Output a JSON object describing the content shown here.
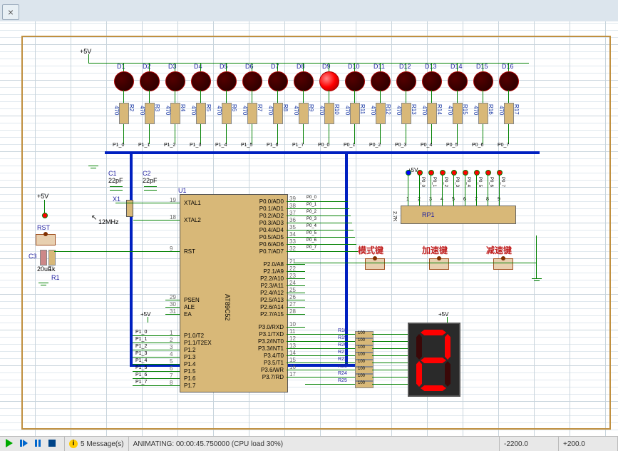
{
  "tab": {
    "close": "×"
  },
  "power": {
    "p5v": "+5V"
  },
  "leds": {
    "names": [
      "D1",
      "D2",
      "D3",
      "D4",
      "D5",
      "D6",
      "D7",
      "D8",
      "D9",
      "D10",
      "D11",
      "D12",
      "D13",
      "D14",
      "D15",
      "D16"
    ],
    "lit_index": 8
  },
  "resistors": {
    "names": [
      "R2",
      "R3",
      "R4",
      "R5",
      "R6",
      "R7",
      "R8",
      "R9",
      "R10",
      "R11",
      "R12",
      "R13",
      "R14",
      "R15",
      "R16",
      "R17"
    ],
    "value": "470"
  },
  "netlabels": [
    "P1_0",
    "P1_1",
    "P1_2",
    "P1_3",
    "P1_4",
    "P1_5",
    "P1_6",
    "P1_7",
    "P0_0",
    "P0_1",
    "P0_2",
    "P0_3",
    "P0_4",
    "P0_5",
    "P0_6",
    "P0_7"
  ],
  "caps": {
    "C1": {
      "name": "C1",
      "val": "22pF"
    },
    "C2": {
      "name": "C2",
      "val": "22pF"
    },
    "C3": {
      "name": "C3",
      "val": "20uF"
    }
  },
  "xtal": {
    "name": "X1",
    "val": "12MHz"
  },
  "rst": {
    "label": "RST",
    "r1": "R1",
    "r1val": "1k"
  },
  "chip": {
    "name": "U1",
    "part": "AT89C52",
    "left": [
      {
        "no": "19",
        "lab": "XTAL1"
      },
      {
        "no": "18",
        "lab": "XTAL2"
      },
      {
        "no": "9",
        "lab": "RST"
      },
      {
        "no": "29",
        "lab": "PSEN"
      },
      {
        "no": "30",
        "lab": "ALE"
      },
      {
        "no": "31",
        "lab": "EA"
      },
      {
        "no": "1",
        "lab": "P1.0/T2"
      },
      {
        "no": "2",
        "lab": "P1.1/T2EX"
      },
      {
        "no": "3",
        "lab": "P1.2"
      },
      {
        "no": "4",
        "lab": "P1.3"
      },
      {
        "no": "5",
        "lab": "P1.4"
      },
      {
        "no": "6",
        "lab": "P1.5"
      },
      {
        "no": "7",
        "lab": "P1.6"
      },
      {
        "no": "8",
        "lab": "P1.7"
      }
    ],
    "right": [
      {
        "no": "39",
        "lab": "P0.0/AD0"
      },
      {
        "no": "38",
        "lab": "P0.1/AD1"
      },
      {
        "no": "37",
        "lab": "P0.2/AD2"
      },
      {
        "no": "36",
        "lab": "P0.3/AD3"
      },
      {
        "no": "35",
        "lab": "P0.4/AD4"
      },
      {
        "no": "34",
        "lab": "P0.5/AD5"
      },
      {
        "no": "33",
        "lab": "P0.6/AD6"
      },
      {
        "no": "32",
        "lab": "P0.7/AD7"
      },
      {
        "no": "21",
        "lab": "P2.0/A8"
      },
      {
        "no": "22",
        "lab": "P2.1/A9"
      },
      {
        "no": "23",
        "lab": "P2.2/A10"
      },
      {
        "no": "24",
        "lab": "P2.3/A11"
      },
      {
        "no": "25",
        "lab": "P2.4/A12"
      },
      {
        "no": "26",
        "lab": "P2.5/A13"
      },
      {
        "no": "27",
        "lab": "P2.6/A14"
      },
      {
        "no": "28",
        "lab": "P2.7/A15"
      },
      {
        "no": "10",
        "lab": "P3.0/RXD"
      },
      {
        "no": "11",
        "lab": "P3.1/TXD"
      },
      {
        "no": "12",
        "lab": "P3.2/INT0"
      },
      {
        "no": "13",
        "lab": "P3.3/INT1"
      },
      {
        "no": "14",
        "lab": "P3.4/T0"
      },
      {
        "no": "15",
        "lab": "P3.5/T1"
      },
      {
        "no": "16",
        "lab": "P3.6/WR"
      },
      {
        "no": "17",
        "lab": "P3.7/RD"
      }
    ]
  },
  "busports_left": [
    "P1_0",
    "P1_1",
    "P1_2",
    "P1_3",
    "P1_4",
    "P1_5",
    "P1_6",
    "P1_7"
  ],
  "rp1": {
    "name": "RP1",
    "val": "2.7K",
    "pins": [
      "1",
      "2",
      "3",
      "4",
      "5",
      "6",
      "7",
      "8",
      "9"
    ],
    "nets": [
      "P0_0",
      "P0_1",
      "P0_2",
      "P0_3",
      "P0_4",
      "P0_5",
      "P0_6",
      "P0_7"
    ]
  },
  "buttons": {
    "mode": "模式键",
    "up": "加速键",
    "down": "减速键"
  },
  "p3res": {
    "names": [
      "R18",
      "R19",
      "R20",
      "R21",
      "R22",
      "R23",
      "R24",
      "R25"
    ],
    "val": "100"
  },
  "seg7": {
    "digit": "2",
    "segs": {
      "a": true,
      "b": true,
      "c": false,
      "d": true,
      "e": true,
      "f": false,
      "g": true
    }
  },
  "status": {
    "messages": "5 Message(s)",
    "anim": "ANIMATING: 00:00:45.750000 (CPU load 30%)",
    "coord_x": "-2200.0",
    "coord_y": "+200.0"
  }
}
